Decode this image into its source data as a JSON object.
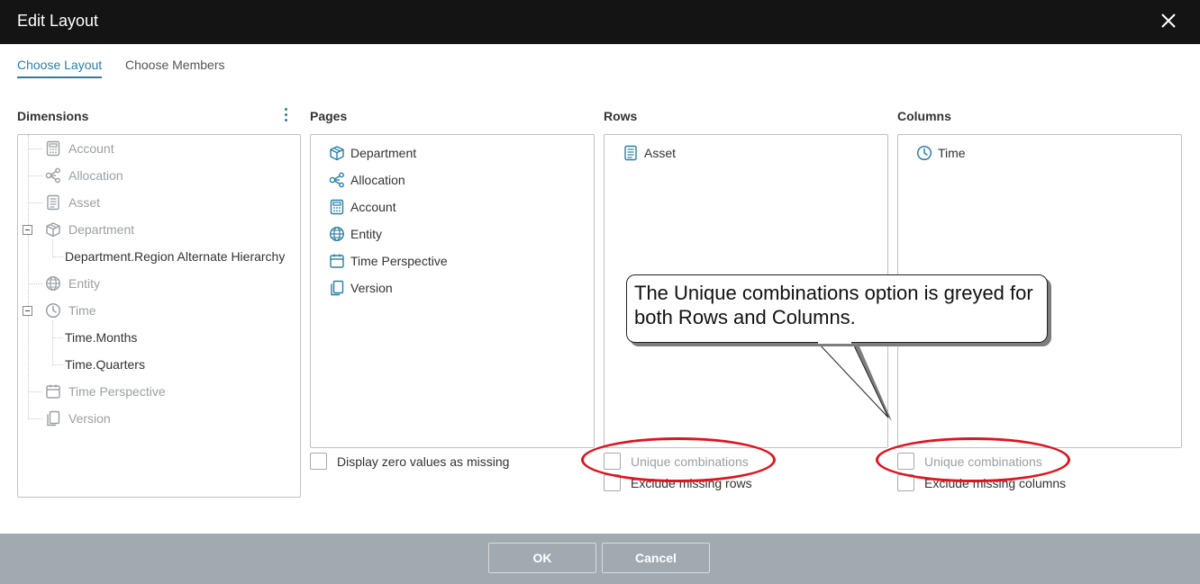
{
  "window": {
    "title": "Edit Layout"
  },
  "tabs": [
    {
      "label": "Choose Layout",
      "active": true
    },
    {
      "label": "Choose Members",
      "active": false
    }
  ],
  "dimensions": {
    "label": "Dimensions",
    "items": [
      {
        "label": "Account",
        "icon": "calculator-icon"
      },
      {
        "label": "Allocation",
        "icon": "share-nodes-icon"
      },
      {
        "label": "Asset",
        "icon": "document-list-icon"
      },
      {
        "label": "Department",
        "icon": "cube-icon",
        "children": [
          "Department.Region Alternate Hierarchy"
        ]
      },
      {
        "label": "Entity",
        "icon": "globe-icon"
      },
      {
        "label": "Time",
        "icon": "clock-icon",
        "children": [
          "Time.Months",
          "Time.Quarters"
        ]
      },
      {
        "label": "Time Perspective",
        "icon": "calendar-icon"
      },
      {
        "label": "Version",
        "icon": "copy-icon"
      }
    ]
  },
  "pages": {
    "label": "Pages",
    "items": [
      {
        "label": "Department",
        "icon": "cube-icon"
      },
      {
        "label": "Allocation",
        "icon": "share-nodes-icon"
      },
      {
        "label": "Account",
        "icon": "calculator-icon"
      },
      {
        "label": "Entity",
        "icon": "globe-icon"
      },
      {
        "label": "Time Perspective",
        "icon": "calendar-icon"
      },
      {
        "label": "Version",
        "icon": "copy-icon"
      }
    ],
    "display_zero_label": "Display zero values as missing"
  },
  "rows": {
    "label": "Rows",
    "items": [
      {
        "label": "Asset",
        "icon": "document-list-icon"
      }
    ],
    "unique_label": "Unique combinations",
    "exclude_label": "Exclude missing rows"
  },
  "columns": {
    "label": "Columns",
    "items": [
      {
        "label": "Time",
        "icon": "clock-icon"
      }
    ],
    "unique_label": "Unique combinations",
    "exclude_label": "Exclude missing columns"
  },
  "callout": {
    "text": "The Unique combinations option is greyed for both Rows and Columns."
  },
  "footer": {
    "ok_label": "OK",
    "cancel_label": "Cancel"
  },
  "colors": {
    "accent": "#2a7fa6",
    "titlebar": "#141414",
    "footer": "#a1a9b1",
    "highlight": "#e0141e",
    "disabled_text": "#9aa0a6"
  }
}
